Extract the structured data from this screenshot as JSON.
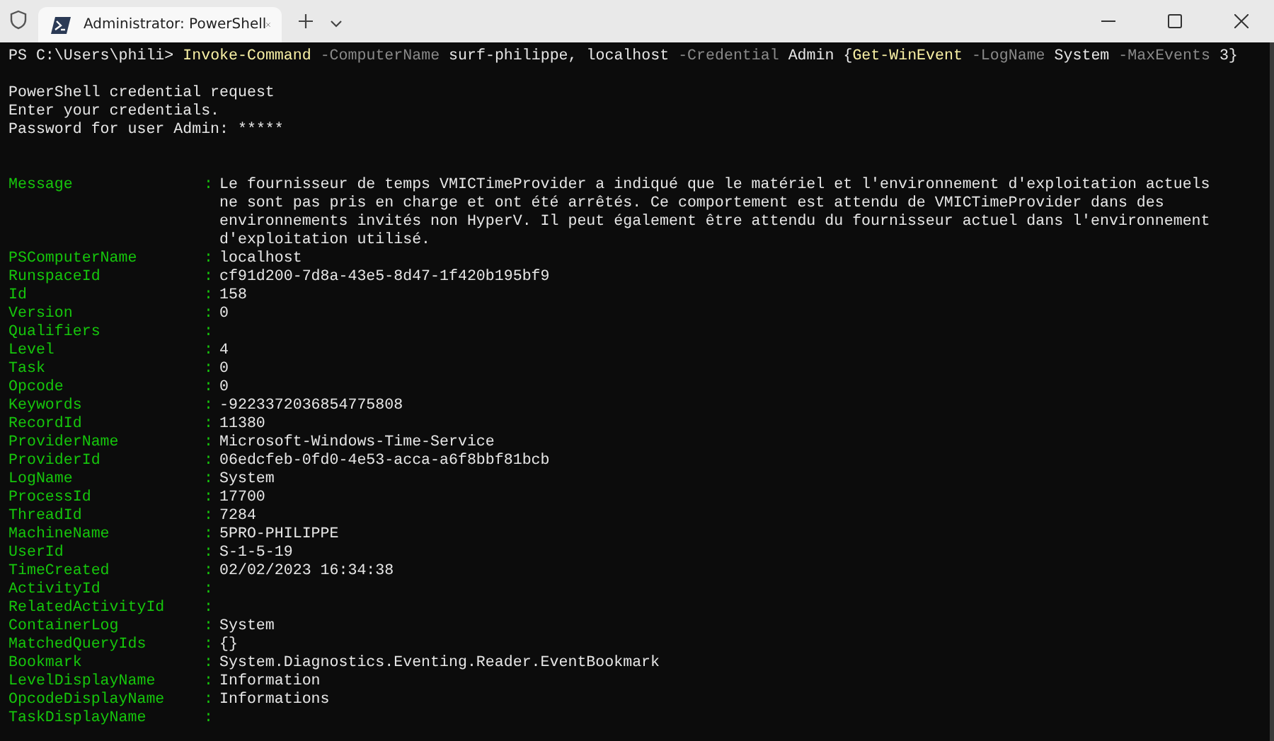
{
  "tab": {
    "title": "Administrator: PowerShell",
    "selected": true
  },
  "command_line": [
    {
      "kind": "prompt",
      "text": "PS C:\\Users\\phili>"
    },
    {
      "kind": "command",
      "text": "Invoke-Command"
    },
    {
      "kind": "parameter",
      "text": "-ComputerName"
    },
    {
      "kind": "argument",
      "text": "surf-philippe,"
    },
    {
      "kind": "argument",
      "text": "localhost"
    },
    {
      "kind": "parameter",
      "text": "-Credential"
    },
    {
      "kind": "argument",
      "text": "Admin"
    },
    {
      "kind": "group_open",
      "text": "{"
    },
    {
      "kind": "command",
      "text": "Get-WinEvent"
    },
    {
      "kind": "parameter",
      "text": "-LogName"
    },
    {
      "kind": "argument",
      "text": "System"
    },
    {
      "kind": "parameter",
      "text": "-MaxEvents"
    },
    {
      "kind": "argument",
      "text": "3}"
    }
  ],
  "credential_prompt": [
    "PowerShell credential request",
    "Enter your credentials.",
    "Password for user Admin: *****"
  ],
  "properties": [
    {
      "name": "Message",
      "value": "Le fournisseur de temps VMICTimeProvider a indiqué que le matériel et l'environnement d'exploitation actuels ne sont pas pris en charge et ont été arrêtés. Ce comportement est attendu de VMICTimeProvider dans des environnements invités non HyperV. Il peut également être attendu du fournisseur actuel dans l'environnement d'exploitation utilisé."
    },
    {
      "name": "PSComputerName",
      "value": "localhost"
    },
    {
      "name": "RunspaceId",
      "value": "cf91d200-7d8a-43e5-8d47-1f420b195bf9"
    },
    {
      "name": "Id",
      "value": "158"
    },
    {
      "name": "Version",
      "value": "0"
    },
    {
      "name": "Qualifiers"
    },
    {
      "name": "Level",
      "value": "4"
    },
    {
      "name": "Task",
      "value": "0"
    },
    {
      "name": "Opcode",
      "value": "0"
    },
    {
      "name": "Keywords",
      "value": "-9223372036854775808"
    },
    {
      "name": "RecordId",
      "value": "11380"
    },
    {
      "name": "ProviderName",
      "value": "Microsoft-Windows-Time-Service"
    },
    {
      "name": "ProviderId",
      "value": "06edcfeb-0fd0-4e53-acca-a6f8bbf81bcb"
    },
    {
      "name": "LogName",
      "value": "System"
    },
    {
      "name": "ProcessId",
      "value": "17700"
    },
    {
      "name": "ThreadId",
      "value": "7284"
    },
    {
      "name": "MachineName",
      "value": "5PRO-PHILIPPE"
    },
    {
      "name": "UserId",
      "value": "S-1-5-19"
    },
    {
      "name": "TimeCreated",
      "value": "02/02/2023 16:34:38"
    },
    {
      "name": "ActivityId"
    },
    {
      "name": "RelatedActivityId"
    },
    {
      "name": "ContainerLog",
      "value": "System"
    },
    {
      "name": "MatchedQueryIds",
      "value": "{}"
    },
    {
      "name": "Bookmark",
      "value": "System.Diagnostics.Eventing.Reader.EventBookmark"
    },
    {
      "name": "LevelDisplayName",
      "value": "Information"
    },
    {
      "name": "OpcodeDisplayName",
      "value": "Informations"
    },
    {
      "name": "TaskDisplayName"
    }
  ],
  "separator": ":"
}
